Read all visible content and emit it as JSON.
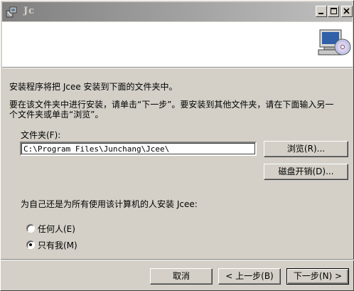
{
  "window": {
    "title": "Jc"
  },
  "intro": {
    "line1": "安装程序将把 Jcee 安装到下面的文件夹中。",
    "line2": "要在该文件夹中进行安装，请单击“下一步”。要安装到其他文件夹，请在下面输入另一",
    "line3": "个文件夹或单击“浏览”。"
  },
  "folder": {
    "label": "文件夹(F):",
    "value": "C:\\Program Files\\Junchang\\Jcee\\",
    "browse_label": "浏览(R)...",
    "disk_cost_label": "磁盘开销(D)..."
  },
  "install_for": {
    "prompt": "为自己还是为所有使用该计算机的人安装 Jcee:",
    "options": [
      {
        "label": "任何人(E)",
        "selected": false
      },
      {
        "label": "只有我(M)",
        "selected": true
      }
    ]
  },
  "footer": {
    "cancel_label": "取消",
    "back_label": "< 上一步(B)",
    "next_label": "下一步(N) >"
  }
}
